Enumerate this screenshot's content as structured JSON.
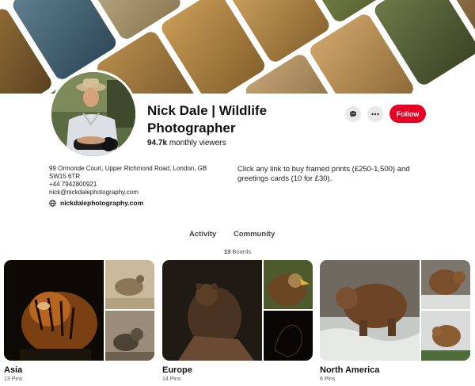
{
  "profile": {
    "name": "Nick Dale | Wildlife Photographer",
    "viewers_count": "94.7k",
    "viewers_label": "monthly viewers",
    "address": "99 Ormonde Court, Upper Richmond Road, London, GB",
    "postcode": "SW15 6TR",
    "phone": "+44 7942800921",
    "email": "nick@nickdalephotography.com",
    "website": "nickdalephotography.com",
    "description": "Click any link to buy framed prints (£250-1,500) and greetings cards (10 for £30).",
    "follow_label": "Follow"
  },
  "tabs": [
    {
      "label": "Activity"
    },
    {
      "label": "Community"
    }
  ],
  "boards_summary": {
    "count": "13",
    "label": "Boards"
  },
  "boards": [
    {
      "title": "Asia",
      "pins": "13 Pins"
    },
    {
      "title": "Europe",
      "pins": "14 Pins"
    },
    {
      "title": "North America",
      "pins": "6 Pins"
    }
  ],
  "icons": {
    "message": "message-icon",
    "more": "more-options-icon",
    "website": "globe-icon"
  },
  "colors": {
    "accent": "#e60023",
    "icon_button_bg": "#e9e9e9"
  }
}
